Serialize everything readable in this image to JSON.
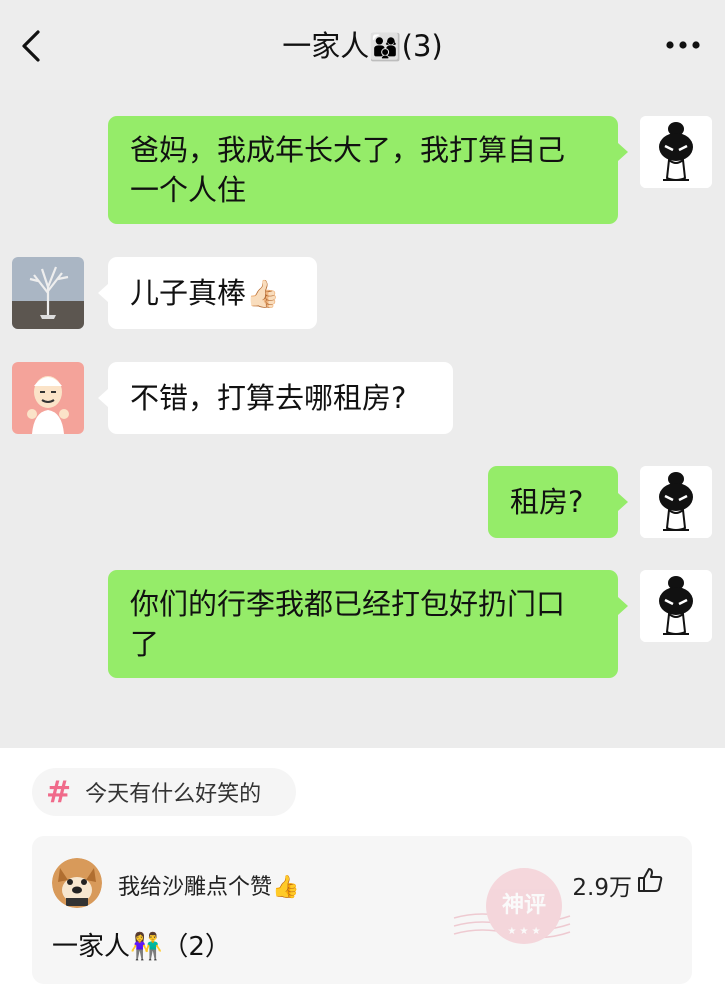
{
  "chat": {
    "title": "一家人",
    "title_emoji": "👨‍👩‍👦",
    "count": "(3)",
    "messages": [
      {
        "from": "me",
        "text_line1": "爸妈，我成年长大了，我打算自己",
        "text_line2": "一个人住"
      },
      {
        "from": "other-1",
        "text": "儿子真棒",
        "emoji": "👍🏻"
      },
      {
        "from": "other-2",
        "text": "不错，打算去哪租房?"
      },
      {
        "from": "me",
        "text": "租房?"
      },
      {
        "from": "me",
        "text_line1": "你们的行李我都已经打包好扔门口",
        "text_line2": "了"
      }
    ]
  },
  "topic": {
    "hash": "#",
    "label": "今天有什么好笑的"
  },
  "comment": {
    "username": "我给沙雕点个赞",
    "username_emoji": "👍",
    "likes": "2.9万",
    "body": "一家人",
    "body_emoji": "👫",
    "body_suffix": "（2）",
    "stamp": "神评"
  },
  "colors": {
    "my_bubble": "#95ec69",
    "other_bubble": "#ffffff",
    "chat_bg": "#ececec",
    "topic_hash": "#f06a8a",
    "stamp": "#e8a0ad"
  },
  "icons": [
    "back-chevron-icon",
    "more-dots-icon",
    "thumbs-up-icon",
    "hashtag-icon"
  ]
}
